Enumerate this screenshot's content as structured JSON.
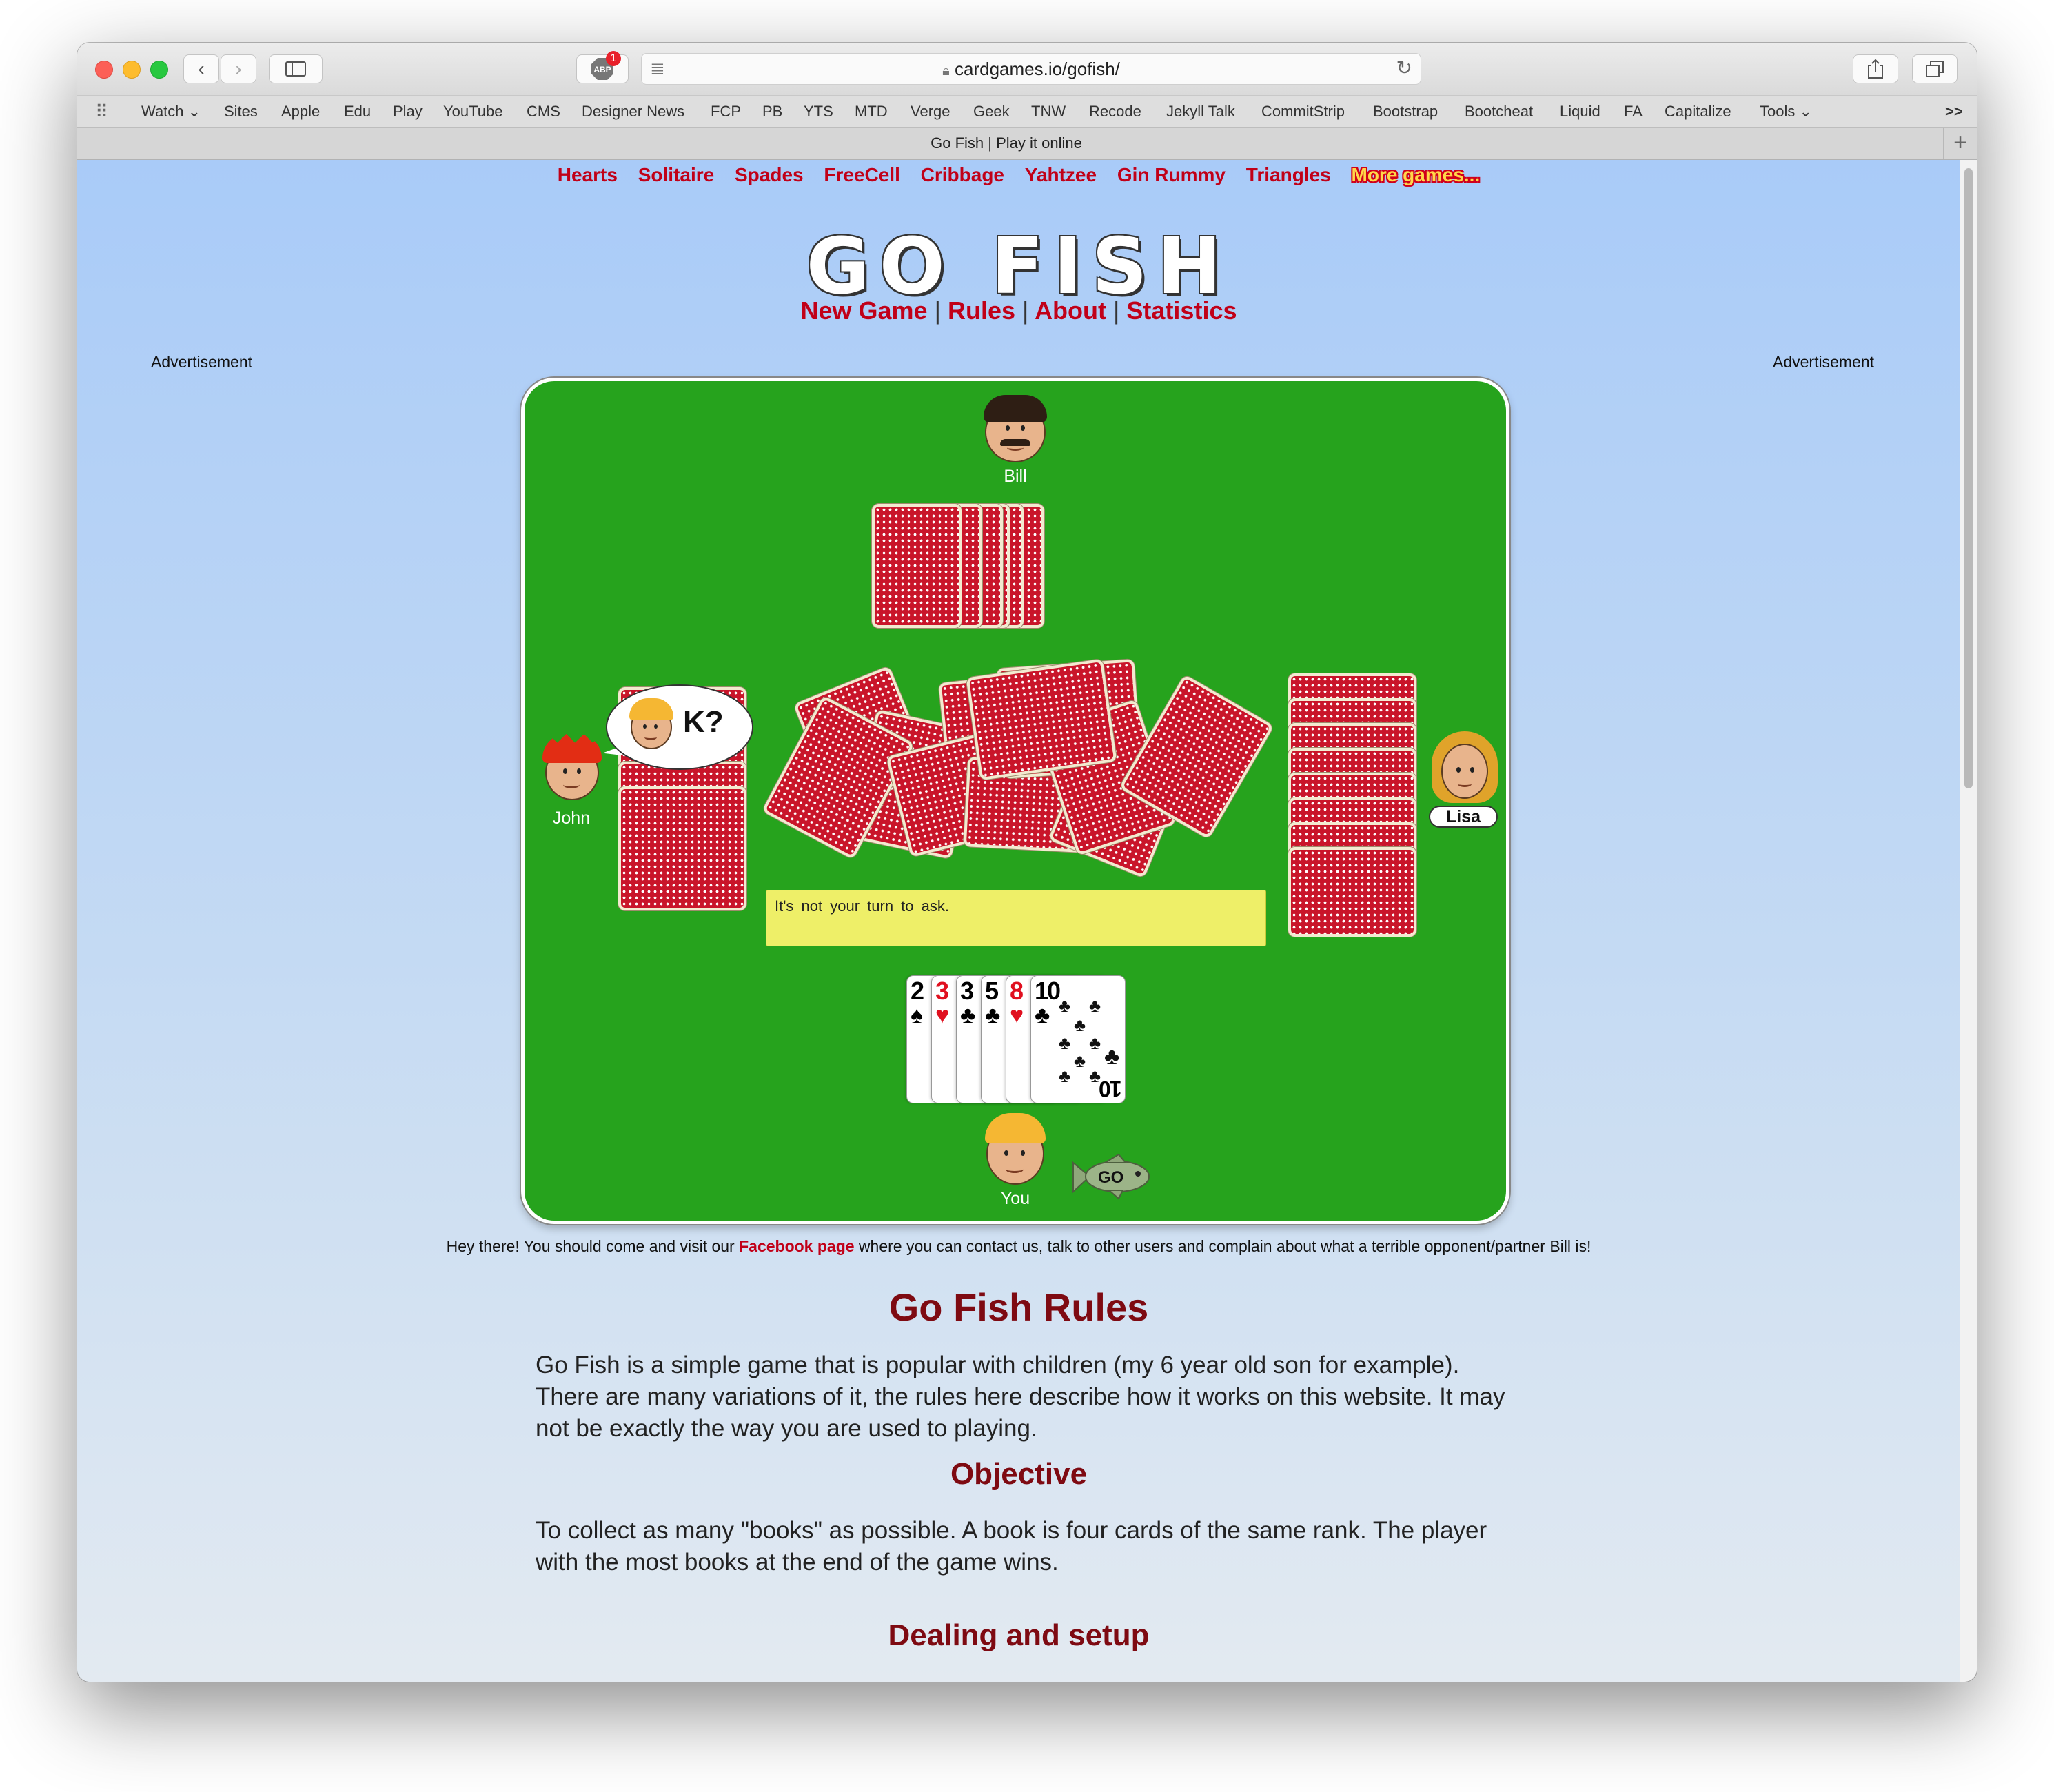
{
  "browser": {
    "url": "cardgames.io/gofish/",
    "tab_title": "Go Fish | Play it online",
    "adblock_badge": "1",
    "bookmarks": [
      "Watch ⌄",
      "Sites",
      "Apple",
      "Edu",
      "Play",
      "YouTube",
      "CMS",
      "Designer News",
      "FCP",
      "PB",
      "YTS",
      "MTD",
      "Verge",
      "Geek",
      "TNW",
      "Recode",
      "Jekyll Talk",
      "CommitStrip",
      "Bootstrap",
      "Bootcheat",
      "Liquid",
      "FA",
      "Capitalize",
      "Tools ⌄"
    ],
    "overflow": ">>",
    "new_tab": "+"
  },
  "site": {
    "top_games": [
      "Hearts",
      "Solitaire",
      "Spades",
      "FreeCell",
      "Cribbage",
      "Yahtzee",
      "Gin Rummy",
      "Triangles"
    ],
    "more_games": "More games...",
    "logo": "GO FISH",
    "nav": [
      "New Game",
      "Rules",
      "About",
      "Statistics"
    ],
    "ad_label": "Advertisement"
  },
  "game": {
    "players": {
      "top": "Bill",
      "left": "John",
      "right": "Lisa",
      "bottom": "You"
    },
    "speech_bubble": "K?",
    "message": "It's not your turn to ask.",
    "hand": [
      {
        "rank": "2",
        "suit": "♠",
        "color": "#111111"
      },
      {
        "rank": "3",
        "suit": "♥",
        "color": "#e0101f"
      },
      {
        "rank": "3",
        "suit": "♣",
        "color": "#111111"
      },
      {
        "rank": "5",
        "suit": "♣",
        "color": "#111111"
      },
      {
        "rank": "8",
        "suit": "♥",
        "color": "#e0101f"
      },
      {
        "rank": "10",
        "suit": "♣",
        "color": "#111111"
      }
    ],
    "go_fish_label": "GO"
  },
  "content": {
    "footnote_before": "Hey there! You should come and visit our ",
    "footnote_link": "Facebook page",
    "footnote_after": " where you can contact us, talk to other users and complain about what a terrible opponent/partner Bill is!",
    "rules_title": "Go Fish Rules",
    "intro": "Go Fish is a simple game that is popular with children (my 6 year old son for example). There are many variations of it, the rules here describe how it works on this website. It may not be exactly the way you are used to playing.",
    "objective_title": "Objective",
    "objective_text": "To collect as many \"books\" as possible. A book is four cards of the same rank. The player with the most books at the end of the game wins.",
    "dealing_title": "Dealing and setup"
  },
  "colors": {
    "board": "#26a31d",
    "nav_red": "#c10018",
    "rules_title": "#7e0a12",
    "message_bg": "#eeef68"
  }
}
